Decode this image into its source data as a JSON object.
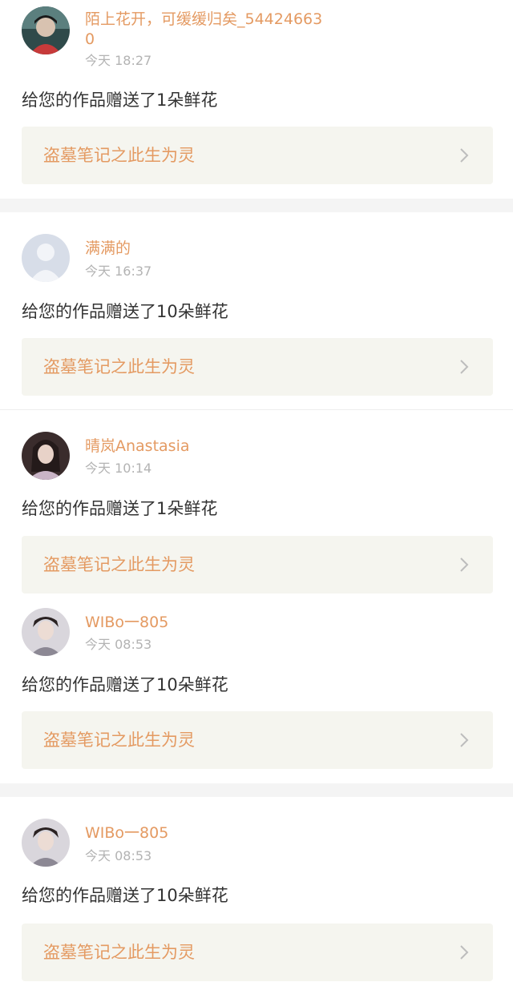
{
  "colors": {
    "accent": "#e49a62",
    "muted": "#b3b3b3",
    "card_bg": "#f5f5ef",
    "divider": "#f4f4f4"
  },
  "notifications": [
    {
      "user_name": "陌上花开，可缓缓归矣_544246630",
      "time": "今天 18:27",
      "message": "给您的作品赠送了1朵鲜花",
      "work_title": "盗墓笔记之此生为灵",
      "avatar_icon": "avatar-photo-icon"
    },
    {
      "user_name": "满满的",
      "time": "今天 16:37",
      "message": "给您的作品赠送了10朵鲜花",
      "work_title": "盗墓笔记之此生为灵",
      "avatar_icon": "default-avatar-icon"
    },
    {
      "user_name": "晴岚Anastasia",
      "time": "今天 10:14",
      "message": "给您的作品赠送了1朵鲜花",
      "work_title": "盗墓笔记之此生为灵",
      "avatar_icon": "avatar-photo-icon"
    },
    {
      "user_name": "WIBo一805",
      "time": "今天 08:53",
      "message": "给您的作品赠送了10朵鲜花",
      "work_title": "盗墓笔记之此生为灵",
      "avatar_icon": "avatar-photo-icon"
    },
    {
      "user_name": "WIBo一805",
      "time": "今天 08:53",
      "message": "给您的作品赠送了10朵鲜花",
      "work_title": "盗墓笔记之此生为灵",
      "avatar_icon": "avatar-photo-icon"
    }
  ]
}
